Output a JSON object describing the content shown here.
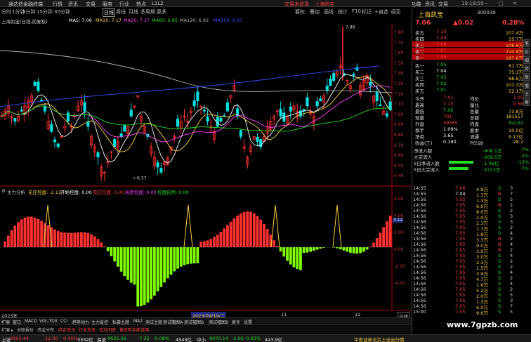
{
  "app": {
    "title": "通达信金融终端",
    "menu": [
      "行情",
      "资讯",
      "交易",
      "服务",
      "行业",
      "热点",
      "L1L2"
    ],
    "right_links": [
      "交易未登录",
      "上海凯宝"
    ],
    "actions": [
      "功能",
      "资讯",
      "交易"
    ],
    "clock": "19:18:59"
  },
  "toolbar": {
    "period_tabs": [
      "分时",
      "1分钟",
      "5分钟",
      "15分钟",
      "30分钟",
      "日线",
      "周线",
      "月线",
      "多周期",
      "更多"
    ],
    "active": "日线",
    "right": [
      "要权",
      "叠加",
      "画线",
      "统计",
      "F10",
      "标记",
      "+自选",
      "返回"
    ]
  },
  "chart": {
    "title": "上海凯宝(日线,前复权)",
    "ma": [
      {
        "t": "MA5: 7.06",
        "c": "#ffffff"
      },
      {
        "t": "MA10: 7.17",
        "c": "#ffd23c"
      },
      {
        "t": "MA20: 7.17",
        "c": "#ff40ff"
      },
      {
        "t": "MA60: 6.95",
        "c": "#22dd22"
      },
      {
        "t": "MA120: 6.92",
        "c": "#b0b0b0"
      },
      {
        "t": "MA250: 6.97",
        "c": "#3050ff"
      }
    ],
    "high": "7.88",
    "low": "6.37",
    "yaxis": [
      "7.80",
      "7.70",
      "7.60",
      "7.50",
      "7.40",
      "7.30",
      "7.20",
      "7.10",
      "7.00",
      "6.90",
      "6.80",
      "6.70",
      "6.60",
      "6.50",
      "6.40"
    ],
    "indicator_name": "主力分析",
    "indicators": [
      {
        "t": "无庄控盘: -2.11",
        "c": "#ffd23c"
      },
      {
        "t": "开始控盘: 0.00",
        "c": "#ffffff"
      },
      {
        "t": "有庄控盘: 0.00",
        "c": "#ff4040"
      },
      {
        "t": "高度控盘: 0.00",
        "c": "#ff40ff"
      },
      {
        "t": "控盘自然: 0.00",
        "c": "#22dd22"
      }
    ],
    "ind_axis": [
      "6.00",
      "4.00",
      "2.00",
      "0.00",
      "-2.00",
      "-4.00"
    ],
    "ind_cur": "3.12",
    "dates": [
      "2023年",
      "2023/09/19/二",
      "10",
      "11",
      "12"
    ],
    "period_btn": "日线",
    "bottom_tabs": [
      "扩展",
      "窗口",
      "MACD",
      "VOL-TDX",
      "CCI",
      "趋势动力",
      "主力监控",
      "私募主题",
      "MA2",
      "测试主题",
      "测试幅图A",
      "测试幅图B",
      "测试幅图B",
      "更多",
      "设置"
    ],
    "bottom_links": [
      "扩展 ▸",
      "关联报价",
      "资金分布",
      "综合资讯",
      "行业资讯",
      "互动问答",
      "首页新功能说明"
    ]
  },
  "quote": {
    "name": "上海凯宝",
    "code": "300039",
    "price": "7.06",
    "change": "▲0.02",
    "pct": "0.28%",
    "asks": [
      {
        "n": "卖五",
        "p": "7.10",
        "v": "107.4万"
      },
      {
        "n": "卖四",
        "p": "7.09",
        "v": "55.7万"
      },
      {
        "n": "卖三",
        "p": "7.08",
        "v": "108.8万"
      },
      {
        "n": "卖二",
        "p": "7.07",
        "v": "210.8万"
      },
      {
        "n": "卖一",
        "p": "7.06",
        "v": "197.6万"
      }
    ],
    "bids": [
      {
        "n": "买一",
        "p": "7.05",
        "v": "81.7万"
      },
      {
        "n": "买二",
        "p": "7.04",
        "v": "75.3万"
      },
      {
        "n": "买三",
        "p": "7.03",
        "v": "68.6万"
      },
      {
        "n": "买四",
        "p": "7.02",
        "v": "101.3万"
      },
      {
        "n": "买五",
        "p": "7.01",
        "v": "52.1万"
      }
    ],
    "stats": [
      [
        "今开",
        "7.01",
        "均价",
        "7.05"
      ],
      [
        "最高",
        "7.13",
        "量比",
        "0.66"
      ],
      [
        "最低",
        "7.00",
        "总量",
        "73.8万"
      ],
      [
        "现量",
        "701",
        "总额",
        "181517"
      ],
      [
        "外盘",
        "39365",
        "内盘",
        "92152"
      ],
      [
        "换手",
        "1.09%",
        "股本",
        "10.5亿"
      ],
      [
        "净资",
        "3.65",
        "流通",
        "9.17亿"
      ],
      [
        "收益(三)",
        "0.190",
        "PE(动)",
        "28.2"
      ]
    ],
    "flows": [
      {
        "n": "净流入额",
        "v": "-908.1万",
        "p": "-7%",
        "w": 0
      },
      {
        "n": "大宗流入",
        "v": "-309.5万",
        "p": "-2%",
        "w": 0
      },
      {
        "n": "5日净流入额",
        "v": "-1.06亿",
        "p": "-13%",
        "w": 35
      },
      {
        "n": "5日大宗流入",
        "v": "-5713万",
        "p": "-7%",
        "w": 28
      }
    ],
    "ticks": [
      [
        "14:55",
        "7.06",
        "4.9万",
        "S",
        "3"
      ],
      [
        "14:55",
        "7.04",
        "1.3万",
        "B",
        "7"
      ],
      [
        "14:56",
        "7.05",
        "1.3万",
        "S",
        "5"
      ],
      [
        "14:56",
        "7.05",
        "6.0万",
        "B",
        "2"
      ],
      [
        "14:56",
        "7.05",
        "8.0万",
        "S",
        "2"
      ],
      [
        "14:56",
        "7.05",
        "2.0万",
        "S",
        "3"
      ],
      [
        "14:56",
        "7.05",
        "2.3万",
        "S",
        "3"
      ],
      [
        "14:56",
        "7.05",
        "1.7万",
        "S",
        "2"
      ],
      [
        "14:56",
        "7.05",
        "1.8万",
        "S",
        "4"
      ],
      [
        "14:56",
        "7.05",
        "3.3万",
        "B",
        "2"
      ],
      [
        "14:56",
        "7.05",
        "9.0万",
        "B",
        "4"
      ],
      [
        "14:56",
        "7.05",
        "3.0万",
        "B",
        "2"
      ],
      [
        "14:56",
        "7.05",
        "3.0万",
        "S",
        "4"
      ],
      [
        "14:56",
        "7.05",
        "2.3万",
        "S",
        "2"
      ],
      [
        "14:56",
        "7.05",
        "1.5万",
        "S",
        "2"
      ],
      [
        "14:56",
        "7.05",
        "3.9万",
        "S",
        "4"
      ],
      [
        "14:56",
        "7.05",
        "4.7万",
        "S",
        "2"
      ],
      [
        "14:56",
        "7.05",
        "1.6万",
        "S",
        "4"
      ],
      [
        "14:56",
        "7.05",
        "5.2万",
        "S",
        "2"
      ],
      [
        "14:56",
        "7.05",
        "2.0万",
        "S",
        "5"
      ],
      [
        "14:56",
        "7.05",
        "1.3万",
        "S",
        "3"
      ],
      [
        "14:56",
        "7.05",
        "6.0万",
        "S",
        "7"
      ],
      [
        "15:00",
        "7.05",
        "9.6万",
        "S",
        "5"
      ]
    ],
    "panel_tabs": [
      "笔",
      "价",
      "细",
      "势",
      "联",
      "值",
      "主",
      "筹"
    ]
  },
  "status": [
    {
      "t": "上证",
      "c": "#fff"
    },
    {
      "t": "3003.44",
      "c": "#ff4040"
    },
    {
      "t": "12.00",
      "c": "#ff4040"
    },
    {
      "t": "0.40%",
      "c": "#ff4040"
    },
    {
      "t": "3332亿",
      "c": "#fff"
    },
    {
      "t": "深证",
      "c": "#fff"
    },
    {
      "t": "9625.26",
      "c": "#22dd22"
    },
    {
      "t": "-7.35",
      "c": "#22dd22"
    },
    {
      "t": "-0.08%",
      "c": "#22dd22"
    },
    {
      "t": "4543亿",
      "c": "#fff"
    },
    {
      "t": "中小",
      "c": "#fff"
    },
    {
      "t": "6070.14",
      "c": "#22dd22"
    },
    {
      "t": "-2.06",
      "c": "#22dd22"
    },
    {
      "t": "-0.03%",
      "c": "#22dd22"
    },
    {
      "t": "423.9亿",
      "c": "#fff"
    },
    {
      "t": "平安证券北京上证云行情",
      "c": "#ffd23c"
    }
  ],
  "watermark": "www.7gpzb.com"
}
